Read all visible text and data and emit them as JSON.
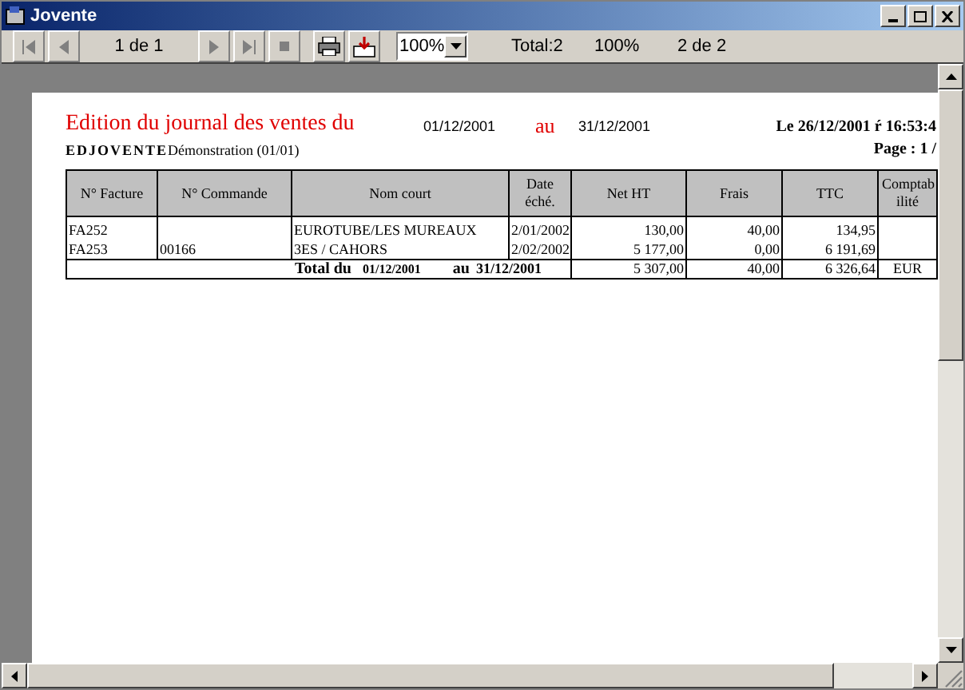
{
  "window": {
    "title": "Jovente"
  },
  "toolbar": {
    "page_label": "1 de 1",
    "zoom": "100%",
    "total": "Total:2",
    "zoom_readout": "100%",
    "pages": "2 de 2"
  },
  "report": {
    "title": "Edition du journal des ventes du",
    "date_from": "01/12/2001",
    "to_word": "au",
    "date_to": "31/12/2001",
    "printed_at": "Le 26/12/2001 ŕ 16:53:4",
    "code": "EDJOVENTE",
    "company": "Démonstration (01/01)",
    "page": "Page : 1 /",
    "columns": [
      "N° Facture",
      "N° Commande",
      "Nom court",
      "Date éché.",
      "Net HT",
      "Frais",
      "TTC",
      "Comptab ilité"
    ],
    "rows": [
      [
        "FA252",
        "",
        "EUROTUBE/LES MUREAUX",
        "2/01/2002",
        "130,00",
        "40,00",
        "134,95",
        ""
      ],
      [
        "FA253",
        "00166",
        "3ES / CAHORS",
        "2/02/2002",
        "5 177,00",
        "0,00",
        "6 191,69",
        ""
      ]
    ],
    "total": {
      "label": "Total du",
      "from": "01/12/2001",
      "to_word": "au",
      "to": "31/12/2001",
      "net": "5 307,00",
      "frais": "40,00",
      "ttc": "6 326,64",
      "currency": "EUR"
    }
  }
}
